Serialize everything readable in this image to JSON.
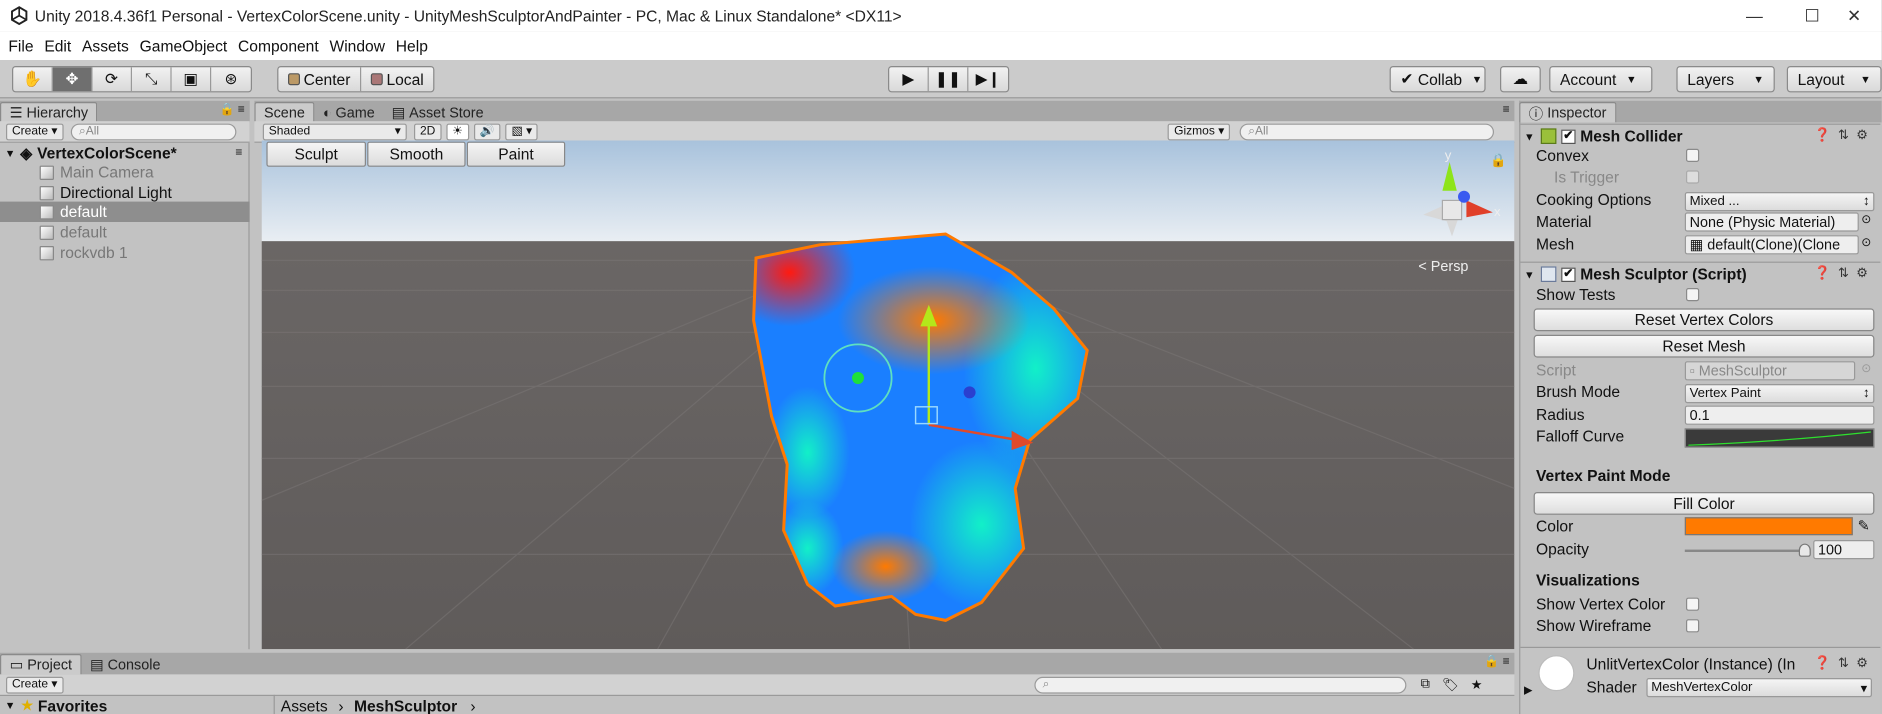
{
  "window": {
    "title": "Unity 2018.4.36f1 Personal - VertexColorScene.unity - UnityMeshSculptorAndPainter - PC, Mac & Linux Standalone* <DX11>",
    "minimize": "—",
    "maximize": "☐",
    "close": "✕"
  },
  "menu": [
    "File",
    "Edit",
    "Assets",
    "GameObject",
    "Component",
    "Window",
    "Help"
  ],
  "toolbar": {
    "pivot": "Center",
    "space": "Local",
    "collab": "Collab",
    "account": "Account",
    "layers": "Layers",
    "layout": "Layout"
  },
  "hierarchy": {
    "tab": "Hierarchy",
    "create": "Create",
    "search_placeholder": "All",
    "scene": "VertexColorScene*",
    "items": [
      {
        "label": "Main Camera",
        "selected": false,
        "dim": true
      },
      {
        "label": "Directional Light",
        "selected": false,
        "dim": false
      },
      {
        "label": "default",
        "selected": true,
        "dim": false
      },
      {
        "label": "default",
        "selected": false,
        "dim": true
      },
      {
        "label": "rockvdb 1",
        "selected": false,
        "dim": true
      }
    ]
  },
  "scene_view": {
    "tabs": [
      "Scene",
      "Game",
      "Asset Store"
    ],
    "shading": "Shaded",
    "mode2d": "2D",
    "gizmos": "Gizmos",
    "search_placeholder": "All",
    "buttons": [
      "Sculpt",
      "Smooth",
      "Paint"
    ],
    "persp": "< Persp",
    "axis_y": "y",
    "axis_x": "x"
  },
  "inspector": {
    "tab": "Inspector",
    "mesh_collider": {
      "title": "Mesh Collider",
      "convex": "Convex",
      "is_trigger": "Is Trigger",
      "cooking_label": "Cooking Options",
      "cooking_value": "Mixed ...",
      "material_label": "Material",
      "material_value": "None (Physic Material)",
      "mesh_label": "Mesh",
      "mesh_value": "default(Clone)(Clone"
    },
    "sculptor": {
      "title": "Mesh Sculptor (Script)",
      "show_tests": "Show Tests",
      "reset_colors": "Reset Vertex Colors",
      "reset_mesh": "Reset Mesh",
      "script_label": "Script",
      "script_value": "MeshSculptor",
      "brush_label": "Brush Mode",
      "brush_value": "Vertex Paint",
      "radius_label": "Radius",
      "radius_value": "0.1",
      "falloff_label": "Falloff Curve",
      "paint_section": "Vertex Paint Mode",
      "fill_color": "Fill Color",
      "color_label": "Color",
      "color_value": "#ff7a00",
      "opacity_label": "Opacity",
      "opacity_value": "100",
      "opacity_fraction": 1.0,
      "vis_section": "Visualizations",
      "show_vertex_color": "Show Vertex Color",
      "show_wireframe": "Show Wireframe"
    },
    "material": {
      "name": "UnlitVertexColor (Instance) (In",
      "shader_label": "Shader",
      "shader_value": "MeshVertexColor"
    }
  },
  "bottom": {
    "tabs": [
      "Project",
      "Console"
    ],
    "create": "Create",
    "favorites": "Favorites",
    "breadcrumb": [
      "Assets",
      "MeshSculptor"
    ]
  },
  "colors": {
    "accent_orange": "#ff7a00",
    "mesh_blue": "#1a7fff",
    "mesh_cyan": "#12f0c8",
    "mesh_red": "#ff2a1a"
  }
}
